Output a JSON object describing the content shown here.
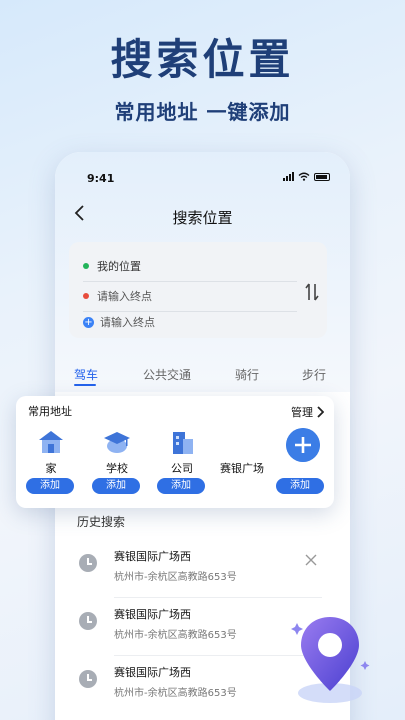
{
  "hero": {
    "title": "搜索位置",
    "subtitle": "常用地址 一键添加"
  },
  "status": {
    "time": "9:41"
  },
  "header": {
    "title": "搜索位置"
  },
  "route": {
    "origin": "我的位置",
    "destination_placeholder": "请输入终点",
    "waypoint_placeholder": "请输入终点"
  },
  "modes": [
    "驾车",
    "公共交通",
    "骑行",
    "步行"
  ],
  "favorites": {
    "title": "常用地址",
    "manage": "管理",
    "items": [
      {
        "label": "家",
        "button": "添加",
        "icon": "home-icon"
      },
      {
        "label": "学校",
        "button": "添加",
        "icon": "school-icon"
      },
      {
        "label": "公司",
        "button": "添加",
        "icon": "office-icon"
      },
      {
        "label": "赛银广场",
        "button": "添加",
        "icon": "plus-icon"
      }
    ]
  },
  "history": {
    "title": "历史搜索",
    "items": [
      {
        "name": "赛银国际广场西",
        "address": "杭州市-余杭区高教路653号"
      },
      {
        "name": "赛银国际广场西",
        "address": "杭州市-余杭区高教路653号"
      },
      {
        "name": "赛银国际广场西",
        "address": "杭州市-余杭区高教路653号"
      }
    ]
  },
  "colors": {
    "accent": "#2f6fe4",
    "title": "#1f3f78",
    "origin_dot": "#22b45a",
    "dest_dot": "#e74c3c"
  }
}
